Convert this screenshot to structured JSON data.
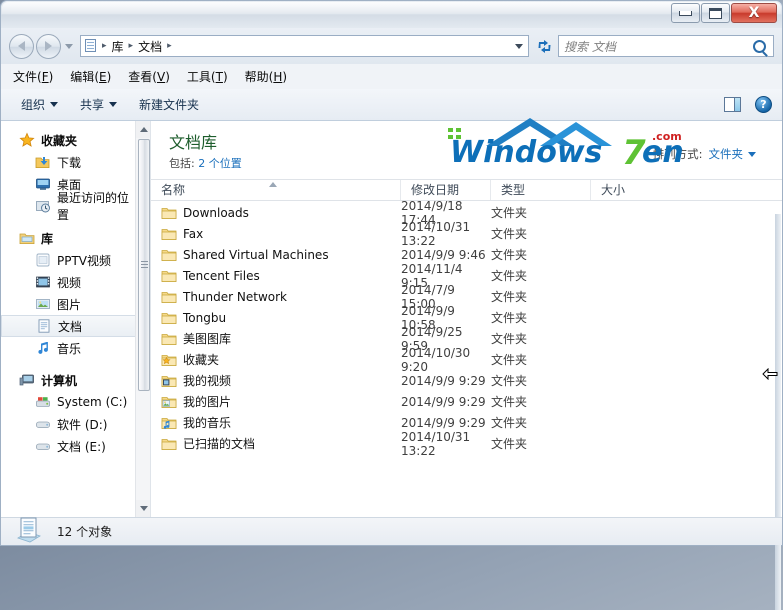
{
  "window": {
    "title": "",
    "controls": {
      "minimize": "–",
      "maximize": "□",
      "close": "X"
    }
  },
  "address": {
    "back_icon": "back-arrow-icon",
    "forward_icon": "forward-arrow-icon",
    "history_caret": "▾",
    "path_icon": "documents-icon",
    "breadcrumbs": [
      "库",
      "文档"
    ],
    "separator": "▸",
    "dropdown_caret": "▾",
    "refresh_label": "↻"
  },
  "search": {
    "placeholder": "搜索 文档",
    "value": "",
    "icon": "search-icon"
  },
  "menu": {
    "items": [
      {
        "text": "文件",
        "key": "F"
      },
      {
        "text": "编辑",
        "key": "E"
      },
      {
        "text": "查看",
        "key": "V"
      },
      {
        "text": "工具",
        "key": "T"
      },
      {
        "text": "帮助",
        "key": "H"
      }
    ]
  },
  "toolbar": {
    "organize_label": "组织",
    "share_label": "共享",
    "new_folder_label": "新建文件夹",
    "preview_pane_icon": "preview-pane-icon",
    "help_icon": "help-icon",
    "help_glyph": "?"
  },
  "watermark": {
    "text": "Windows7en",
    "suffix": ".com",
    "primary_color": "#0d6fb8",
    "accent_color": "#5ec234"
  },
  "sidebar": {
    "groups": [
      {
        "label": "收藏夹",
        "icon": "star-icon",
        "items": [
          {
            "label": "下载",
            "icon": "downloads-icon",
            "selected": false
          },
          {
            "label": "桌面",
            "icon": "desktop-icon",
            "selected": false
          },
          {
            "label": "最近访问的位置",
            "icon": "recent-places-icon",
            "selected": false
          }
        ]
      },
      {
        "label": "库",
        "icon": "library-icon",
        "items": [
          {
            "label": "PPTV视频",
            "icon": "pptv-library-icon",
            "selected": false
          },
          {
            "label": "视频",
            "icon": "video-library-icon",
            "selected": false
          },
          {
            "label": "图片",
            "icon": "pictures-library-icon",
            "selected": false
          },
          {
            "label": "文档",
            "icon": "documents-library-icon",
            "selected": true
          },
          {
            "label": "音乐",
            "icon": "music-library-icon",
            "selected": false
          }
        ]
      },
      {
        "label": "计算机",
        "icon": "computer-icon",
        "items": [
          {
            "label": "System (C:)",
            "icon": "system-drive-icon",
            "selected": false
          },
          {
            "label": "软件 (D:)",
            "icon": "drive-icon",
            "selected": false
          },
          {
            "label": "文档 (E:)",
            "icon": "drive-icon",
            "selected": false
          }
        ]
      }
    ],
    "scrollbar": {
      "up_caret": "▲",
      "down_caret": "▼"
    }
  },
  "library": {
    "title": "文档库",
    "includes_label": "包括:",
    "includes_value": "2 个位置",
    "arrange_label": "排列方式:",
    "arrange_value": "文件夹",
    "arrange_caret": "▾"
  },
  "file_list": {
    "columns": [
      "名称",
      "修改日期",
      "类型",
      "大小"
    ],
    "sort_column": "名称",
    "sort_direction": "asc",
    "rows": [
      {
        "name": "Downloads",
        "date": "2014/9/18 17:44",
        "type": "文件夹",
        "size": "",
        "icon": "folder-icon"
      },
      {
        "name": "Fax",
        "date": "2014/10/31 13:22",
        "type": "文件夹",
        "size": "",
        "icon": "folder-icon"
      },
      {
        "name": "Shared Virtual Machines",
        "date": "2014/9/9 9:46",
        "type": "文件夹",
        "size": "",
        "icon": "folder-icon"
      },
      {
        "name": "Tencent Files",
        "date": "2014/11/4 9:15",
        "type": "文件夹",
        "size": "",
        "icon": "folder-icon"
      },
      {
        "name": "Thunder Network",
        "date": "2014/7/9 15:00",
        "type": "文件夹",
        "size": "",
        "icon": "folder-icon"
      },
      {
        "name": "Tongbu",
        "date": "2014/9/9 10:58",
        "type": "文件夹",
        "size": "",
        "icon": "folder-icon"
      },
      {
        "name": "美图图库",
        "date": "2014/9/25 9:59",
        "type": "文件夹",
        "size": "",
        "icon": "folder-icon"
      },
      {
        "name": "收藏夹",
        "date": "2014/10/30 9:20",
        "type": "文件夹",
        "size": "",
        "icon": "favorites-folder-icon"
      },
      {
        "name": "我的视频",
        "date": "2014/9/9 9:29",
        "type": "文件夹",
        "size": "",
        "icon": "my-videos-folder-icon"
      },
      {
        "name": "我的图片",
        "date": "2014/9/9 9:29",
        "type": "文件夹",
        "size": "",
        "icon": "my-pictures-folder-icon"
      },
      {
        "name": "我的音乐",
        "date": "2014/9/9 9:29",
        "type": "文件夹",
        "size": "",
        "icon": "my-music-folder-icon"
      },
      {
        "name": "已扫描的文档",
        "date": "2014/10/31 13:22",
        "type": "文件夹",
        "size": "",
        "icon": "folder-icon"
      }
    ]
  },
  "status": {
    "icon": "library-document-icon",
    "text": "12 个对象"
  }
}
